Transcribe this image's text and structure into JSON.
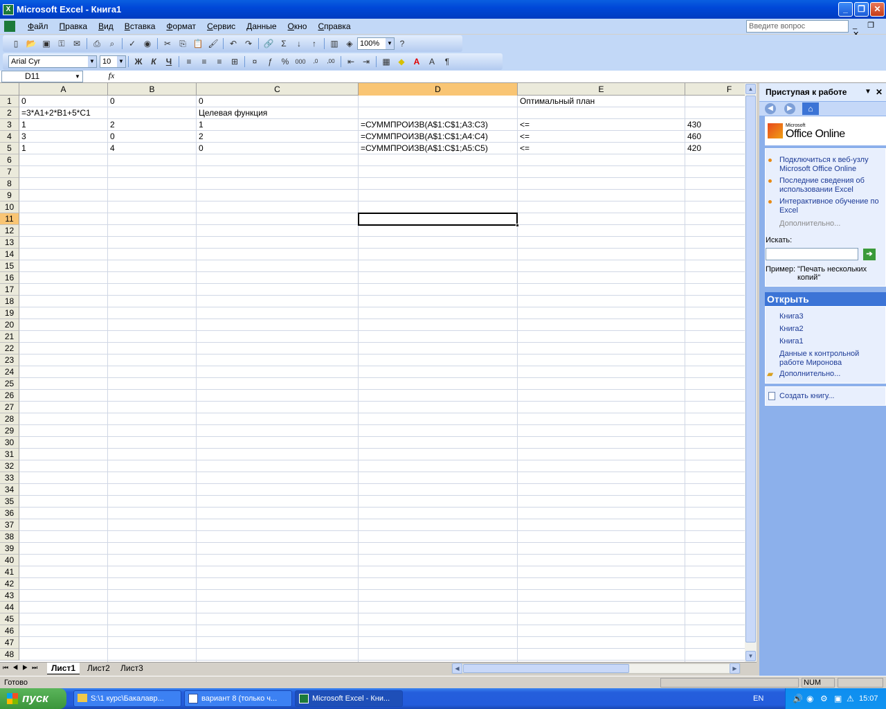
{
  "window": {
    "title": "Microsoft Excel - Книга1",
    "min": "_",
    "max": "❐",
    "close": "✕"
  },
  "menu": [
    "Файл",
    "Правка",
    "Вид",
    "Вставка",
    "Формат",
    "Сервис",
    "Данные",
    "Окно",
    "Справка"
  ],
  "ask_placeholder": "Введите вопрос",
  "toolbar": {
    "zoom": "100%",
    "font": "Arial Cyr",
    "size": "10",
    "bold": "Ж",
    "italic": "К",
    "underline": "Ч"
  },
  "formula": {
    "namebox": "D11",
    "fx": "fx",
    "content": ""
  },
  "columns": [
    {
      "label": "A"
    },
    {
      "label": "B"
    },
    {
      "label": "C"
    },
    {
      "label": "D"
    },
    {
      "label": "E"
    },
    {
      "label": "F"
    }
  ],
  "selected": {
    "col": "D",
    "row": 11
  },
  "rows_count": 48,
  "cells": [
    {
      "r": 1,
      "c": 0,
      "v": "0"
    },
    {
      "r": 1,
      "c": 1,
      "v": "0"
    },
    {
      "r": 1,
      "c": 2,
      "v": "0"
    },
    {
      "r": 1,
      "c": 4,
      "v": "Оптимальный план"
    },
    {
      "r": 2,
      "c": 0,
      "v": "=3*A1+2*B1+5*C1"
    },
    {
      "r": 2,
      "c": 2,
      "v": "Целевая функция"
    },
    {
      "r": 3,
      "c": 0,
      "v": "1"
    },
    {
      "r": 3,
      "c": 1,
      "v": "2"
    },
    {
      "r": 3,
      "c": 2,
      "v": "1"
    },
    {
      "r": 3,
      "c": 3,
      "v": "=СУММПРОИЗВ(A$1:C$1;A3:C3)"
    },
    {
      "r": 3,
      "c": 4,
      "v": "<="
    },
    {
      "r": 3,
      "c": 5,
      "v": "430"
    },
    {
      "r": 4,
      "c": 0,
      "v": "3"
    },
    {
      "r": 4,
      "c": 1,
      "v": "0"
    },
    {
      "r": 4,
      "c": 2,
      "v": "2"
    },
    {
      "r": 4,
      "c": 3,
      "v": "=СУММПРОИЗВ(A$1:C$1;A4:C4)"
    },
    {
      "r": 4,
      "c": 4,
      "v": "<="
    },
    {
      "r": 4,
      "c": 5,
      "v": "460"
    },
    {
      "r": 5,
      "c": 0,
      "v": "1"
    },
    {
      "r": 5,
      "c": 1,
      "v": "4"
    },
    {
      "r": 5,
      "c": 2,
      "v": "0"
    },
    {
      "r": 5,
      "c": 3,
      "v": "=СУММПРОИЗВ(A$1:C$1;A5:C5)"
    },
    {
      "r": 5,
      "c": 4,
      "v": "<="
    },
    {
      "r": 5,
      "c": 5,
      "v": "420"
    }
  ],
  "sheets": [
    "Лист1",
    "Лист2",
    "Лист3"
  ],
  "taskpane": {
    "title": "Приступая к работе",
    "logo_small": "Microsoft",
    "logo": "Office Online",
    "links": [
      "Подключиться к веб-узлу Microsoft Office Online",
      "Последние сведения об использовании Excel",
      "Интерактивное обучение по Excel"
    ],
    "more": "Дополнительно...",
    "search_label": "Искать:",
    "example_label": "Пример:",
    "example_text": "\"Печать нескольких копий\"",
    "open_header": "Открыть",
    "files": [
      "Книга3",
      "Книга2",
      "Книга1",
      "Данные к контрольной работе Миронова"
    ],
    "open_more": "Дополнительно...",
    "create": "Создать книгу..."
  },
  "status": {
    "left": "Готово",
    "num": "NUM"
  },
  "taskbar": {
    "start": "пуск",
    "tasks": [
      "S:\\1 курс\\Бакалавр...",
      "вариант 8 (только ч...",
      "Microsoft Excel - Кни..."
    ],
    "lang": "EN",
    "clock": "15:07"
  }
}
